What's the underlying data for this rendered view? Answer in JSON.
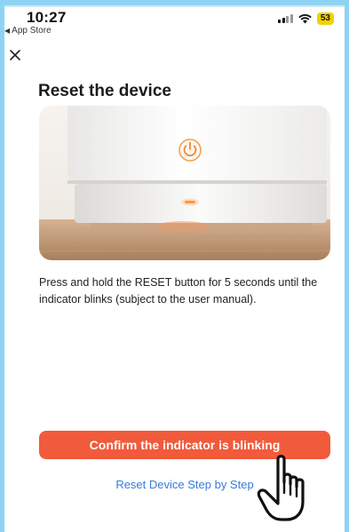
{
  "status_bar": {
    "time": "10:27",
    "back_app_label": "App Store",
    "battery_level": "53",
    "signal_icon": "signal-bars-icon",
    "wifi_icon": "wifi-icon"
  },
  "nav": {
    "close_icon": "close-icon"
  },
  "page": {
    "title": "Reset the device",
    "instruction": "Press and hold the RESET button for 5 seconds until the indicator blinks (subject to the user manual).",
    "confirm_button_label": "Confirm the indicator is blinking",
    "reset_link_label": "Reset Device Step by Step"
  },
  "colors": {
    "accent": "#f15a3b",
    "link": "#3a7bd5",
    "indicator": "#ff8a2a",
    "backdrop": "#8fd3f4"
  }
}
